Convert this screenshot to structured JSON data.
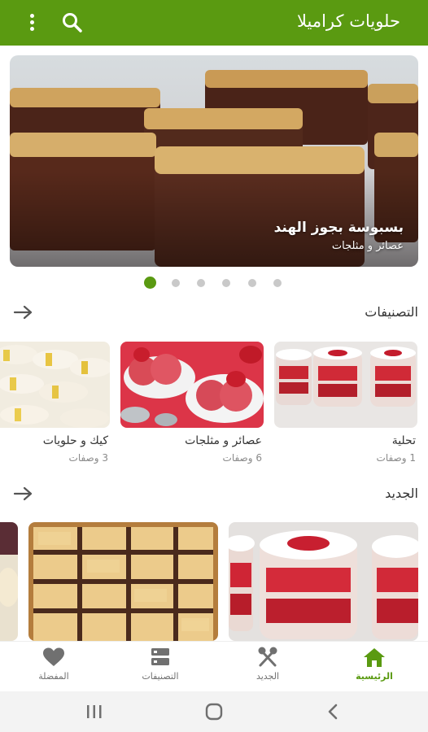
{
  "app": {
    "title": "حلويات كراميلا"
  },
  "icons": {
    "menu": "more-vert-icon",
    "search": "search-icon"
  },
  "colors": {
    "primary": "#5a9a11",
    "inactive": "#707070"
  },
  "hero": {
    "title": "بسبوسة بجوز الهند",
    "subtitle": "عصائر و مثلجات",
    "slide_count": 6,
    "active_slide": 1
  },
  "categories": {
    "header": "التصنيفات",
    "items": [
      {
        "name": "تحلية",
        "count": "1 وصفات"
      },
      {
        "name": "عصائر و مثلجات",
        "count": "6 وصفات"
      },
      {
        "name": "كيك و حلويات",
        "count": "3 وصفات"
      }
    ]
  },
  "new": {
    "header": "الجديد"
  },
  "bottom_nav": {
    "items": [
      {
        "label": "الرئيسية",
        "icon": "home-icon",
        "active": true
      },
      {
        "label": "الجديد",
        "icon": "fork-knife-icon",
        "active": false
      },
      {
        "label": "التصنيفات",
        "icon": "categories-icon",
        "active": false
      },
      {
        "label": "المفضلة",
        "icon": "heart-icon",
        "active": false
      }
    ]
  },
  "system_nav": {
    "icons": [
      "recents-icon",
      "home-circle-icon",
      "back-icon"
    ]
  }
}
